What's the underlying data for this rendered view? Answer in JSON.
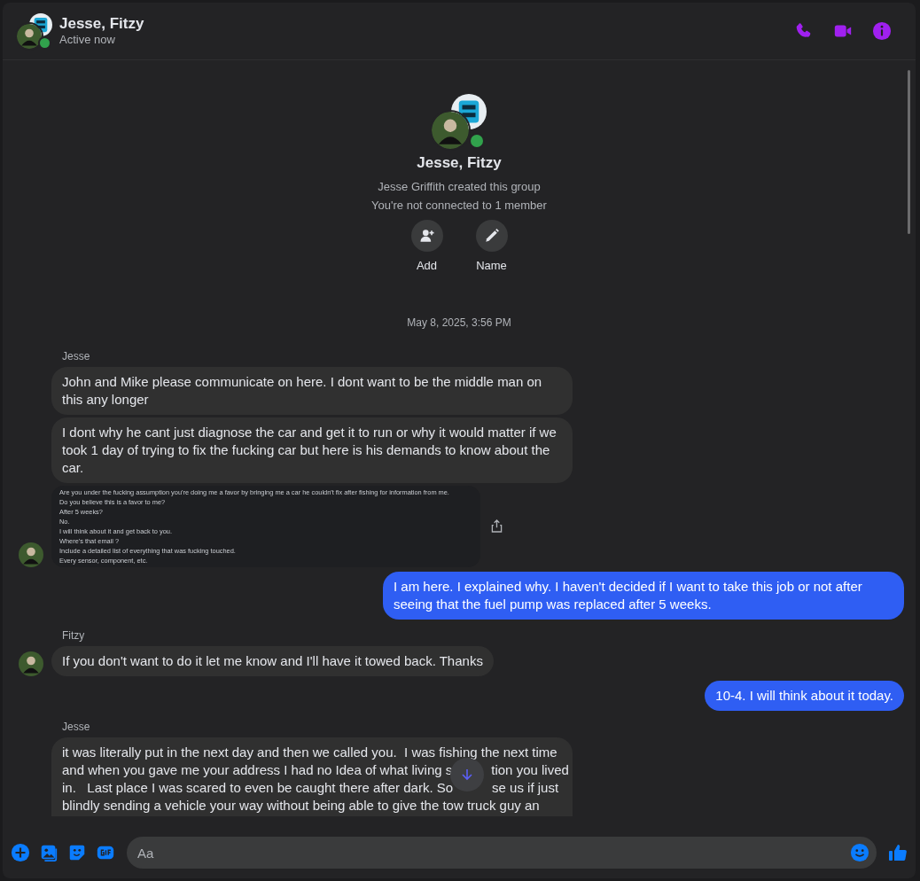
{
  "header": {
    "title": "Jesse, Fitzy",
    "status": "Active now",
    "online": true
  },
  "intro": {
    "title": "Jesse, Fitzy",
    "online": true,
    "lines": [
      "Jesse Griffith created this group",
      "You're not connected to 1 member"
    ],
    "actions": [
      {
        "label": "Add",
        "kind": "add"
      },
      {
        "label": "Name",
        "kind": "name"
      }
    ]
  },
  "timestamp": "May 8, 2025, 3:56 PM",
  "messages": [
    {
      "kind": "sender",
      "text": "Jesse"
    },
    {
      "kind": "text",
      "outgoing": false,
      "avatar": false,
      "text": "John and Mike please communicate on here.  I dont want to be the middle man on this any longer"
    },
    {
      "kind": "text",
      "outgoing": false,
      "avatar": false,
      "text": "I dont why he cant just diagnose the car and get it to run or why it would matter if we took 1 day of trying to fix the fucking car but here is his demands to know about the car."
    },
    {
      "kind": "image",
      "outgoing": false,
      "avatar": true,
      "lines": [
        "Are you under the fucking assumption you're doing me a favor by bringing me a car he couldn't fix after fishing for information from me.",
        "Do you believe this is a favor to me?",
        "After 5 weeks?",
        "No.",
        "I will think about it and get back to you.",
        "Where's that email ?",
        "Include a detailed list of everything that was fucking touched.",
        "Every sensor, component, etc."
      ]
    },
    {
      "kind": "text",
      "outgoing": true,
      "text": "I am here. I explained why. I haven't decided if I want to take this job or not after seeing that the fuel pump was replaced after 5 weeks."
    },
    {
      "kind": "sender",
      "text": "Fitzy"
    },
    {
      "kind": "text",
      "outgoing": false,
      "avatar": true,
      "text": "If you don't want to do it let me know and I'll have it towed back. Thanks"
    },
    {
      "kind": "text",
      "outgoing": true,
      "text": "10-4. I will think about it today."
    },
    {
      "kind": "sender",
      "text": "Jesse"
    },
    {
      "kind": "lines",
      "outgoing": false,
      "avatar": false,
      "lines": [
        [
          "it was literally put in the next day and then we called you.  I was fishing the next time"
        ],
        [
          "and when you gave me your address I had no Idea of what living s",
          "tion you lived"
        ],
        [
          "in.   Last place I was scared to even be caught there after dark. So",
          "se us if just"
        ],
        [
          "blindly sending a vehicle your way without being able to give the tow truck guy an"
        ]
      ]
    }
  ],
  "composer": {
    "placeholder": "Aa"
  }
}
